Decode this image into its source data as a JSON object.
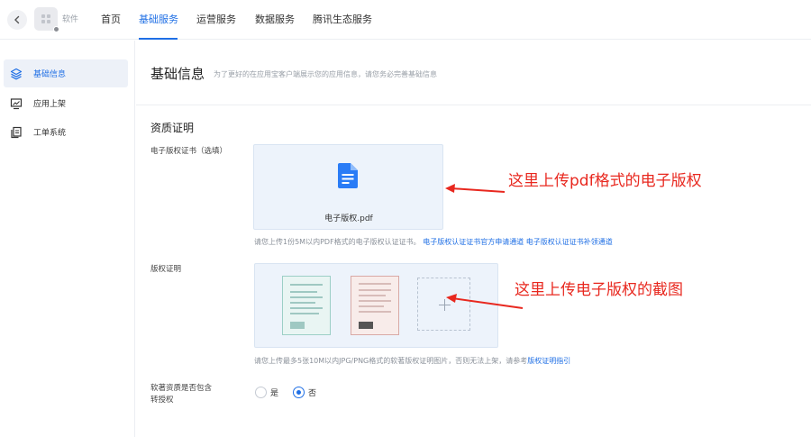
{
  "header": {
    "app_name": "软件",
    "tabs": [
      {
        "label": "首页"
      },
      {
        "label": "基础服务"
      },
      {
        "label": "运营服务"
      },
      {
        "label": "数据服务"
      },
      {
        "label": "腾讯生态服务"
      }
    ],
    "active_tab": "基础服务"
  },
  "sidebar": {
    "items": [
      {
        "label": "基础信息",
        "icon": "layers-icon",
        "active": true
      },
      {
        "label": "应用上架",
        "icon": "monitor-icon",
        "active": false
      },
      {
        "label": "工单系统",
        "icon": "documents-icon",
        "active": false
      }
    ]
  },
  "main": {
    "title": "基础信息",
    "subtitle": "为了更好的在应用宝客户端展示您的应用信息，请您务必完善基础信息",
    "section_title": "资质证明",
    "copyright_cert": {
      "label": "电子版权证书（选填）",
      "file_name": "电子版权.pdf",
      "hint": "请您上传1份5M以内PDF格式的电子版权认证证书。",
      "link_official": "电子版权认证证书官方申请通道",
      "link_supplement": "电子版权认证证书补领通道"
    },
    "copyright_proof": {
      "label": "版权证明",
      "hint_prefix": "请您上传最多5张10M以内JPG/PNG格式的软著版权证明图片，否则无法上架，请参考",
      "hint_link": "版权证明指引"
    },
    "transfer": {
      "label_line1": "软著资质是否包含",
      "label_line2": "转授权",
      "options": [
        {
          "label": "是",
          "checked": false
        },
        {
          "label": "否",
          "checked": true
        }
      ]
    }
  },
  "annotations": {
    "pdf_note": "这里上传pdf格式的电子版权",
    "screenshot_note": "这里上传电子版权的截图",
    "color": "#e8281f"
  },
  "colors": {
    "accent": "#1f6fe5",
    "upload_bg": "#edf3fb"
  }
}
